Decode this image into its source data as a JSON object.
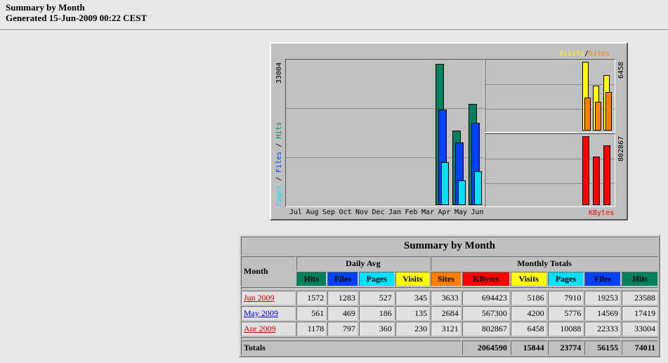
{
  "header": {
    "title": "Summary by Month",
    "generated": "Generated 15-Jun-2009 00:22 CEST"
  },
  "graph": {
    "legend_visits": "Visits",
    "legend_sites": "Sites",
    "legend_pages": "Pages",
    "legend_files": "Files",
    "legend_hits": "Hits",
    "kbytes_label": "KBytes",
    "max_hits": "33004",
    "max_visits": "6458",
    "max_kbytes": "802867",
    "months": [
      "Jul",
      "Aug",
      "Sep",
      "Oct",
      "Nov",
      "Dec",
      "Jan",
      "Feb",
      "Mar",
      "Apr",
      "May",
      "Jun"
    ],
    "colors": {
      "hits": "#00805c",
      "files": "#0040ff",
      "pages": "#00e0ff",
      "visits": "#ffff00",
      "sites": "#ff8000",
      "kbytes": "#ff0000"
    }
  },
  "chart_data": {
    "type": "bar",
    "categories": [
      "Apr",
      "May",
      "Jun"
    ],
    "series": [
      {
        "name": "Hits",
        "values": [
          33004,
          17419,
          23588
        ]
      },
      {
        "name": "Files",
        "values": [
          22333,
          14569,
          19253
        ]
      },
      {
        "name": "Pages",
        "values": [
          10088,
          5776,
          7910
        ]
      },
      {
        "name": "Visits",
        "values": [
          6458,
          4200,
          5186
        ]
      },
      {
        "name": "Sites",
        "values": [
          3121,
          2684,
          3633
        ]
      },
      {
        "name": "KBytes",
        "values": [
          802867,
          567300,
          694423
        ]
      }
    ]
  },
  "table": {
    "title": "Summary by Month",
    "month_header": "Month",
    "daily_avg": "Daily Avg",
    "monthly_totals": "Monthly Totals",
    "daily_cols": [
      "Hits",
      "Files",
      "Pages",
      "Visits"
    ],
    "monthly_cols": [
      "Sites",
      "KBytes",
      "Visits",
      "Pages",
      "Files",
      "Hits"
    ],
    "rows": [
      {
        "month": "Jun 2009",
        "daily": [
          "1572",
          "1283",
          "527",
          "345"
        ],
        "monthly": [
          "3633",
          "694423",
          "5186",
          "7910",
          "19253",
          "23588"
        ]
      },
      {
        "month": "May 2009",
        "daily": [
          "561",
          "469",
          "186",
          "135"
        ],
        "monthly": [
          "2684",
          "567300",
          "4200",
          "5776",
          "14569",
          "17419"
        ]
      },
      {
        "month": "Apr 2009",
        "daily": [
          "1178",
          "797",
          "360",
          "230"
        ],
        "monthly": [
          "3121",
          "802867",
          "6458",
          "10088",
          "22333",
          "33004"
        ]
      }
    ],
    "totals": {
      "label": "Totals",
      "values": [
        "2064590",
        "15844",
        "23774",
        "56155",
        "74011"
      ]
    }
  }
}
